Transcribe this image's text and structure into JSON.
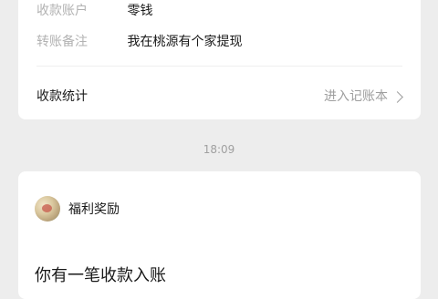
{
  "payment_card": {
    "rows": [
      {
        "label": "收款账户",
        "value": "零钱"
      },
      {
        "label": "转账备注",
        "value": "我在桃源有个家提现"
      }
    ],
    "stats": {
      "title": "收款统计",
      "link_label": "进入记账本"
    }
  },
  "timestamp": "18:09",
  "reward_card": {
    "title": "福利奖励",
    "message": "你有一笔收款入账"
  },
  "icons": {
    "chevron": "chevron-right-icon",
    "avatar": "reward-avatar-icon"
  }
}
